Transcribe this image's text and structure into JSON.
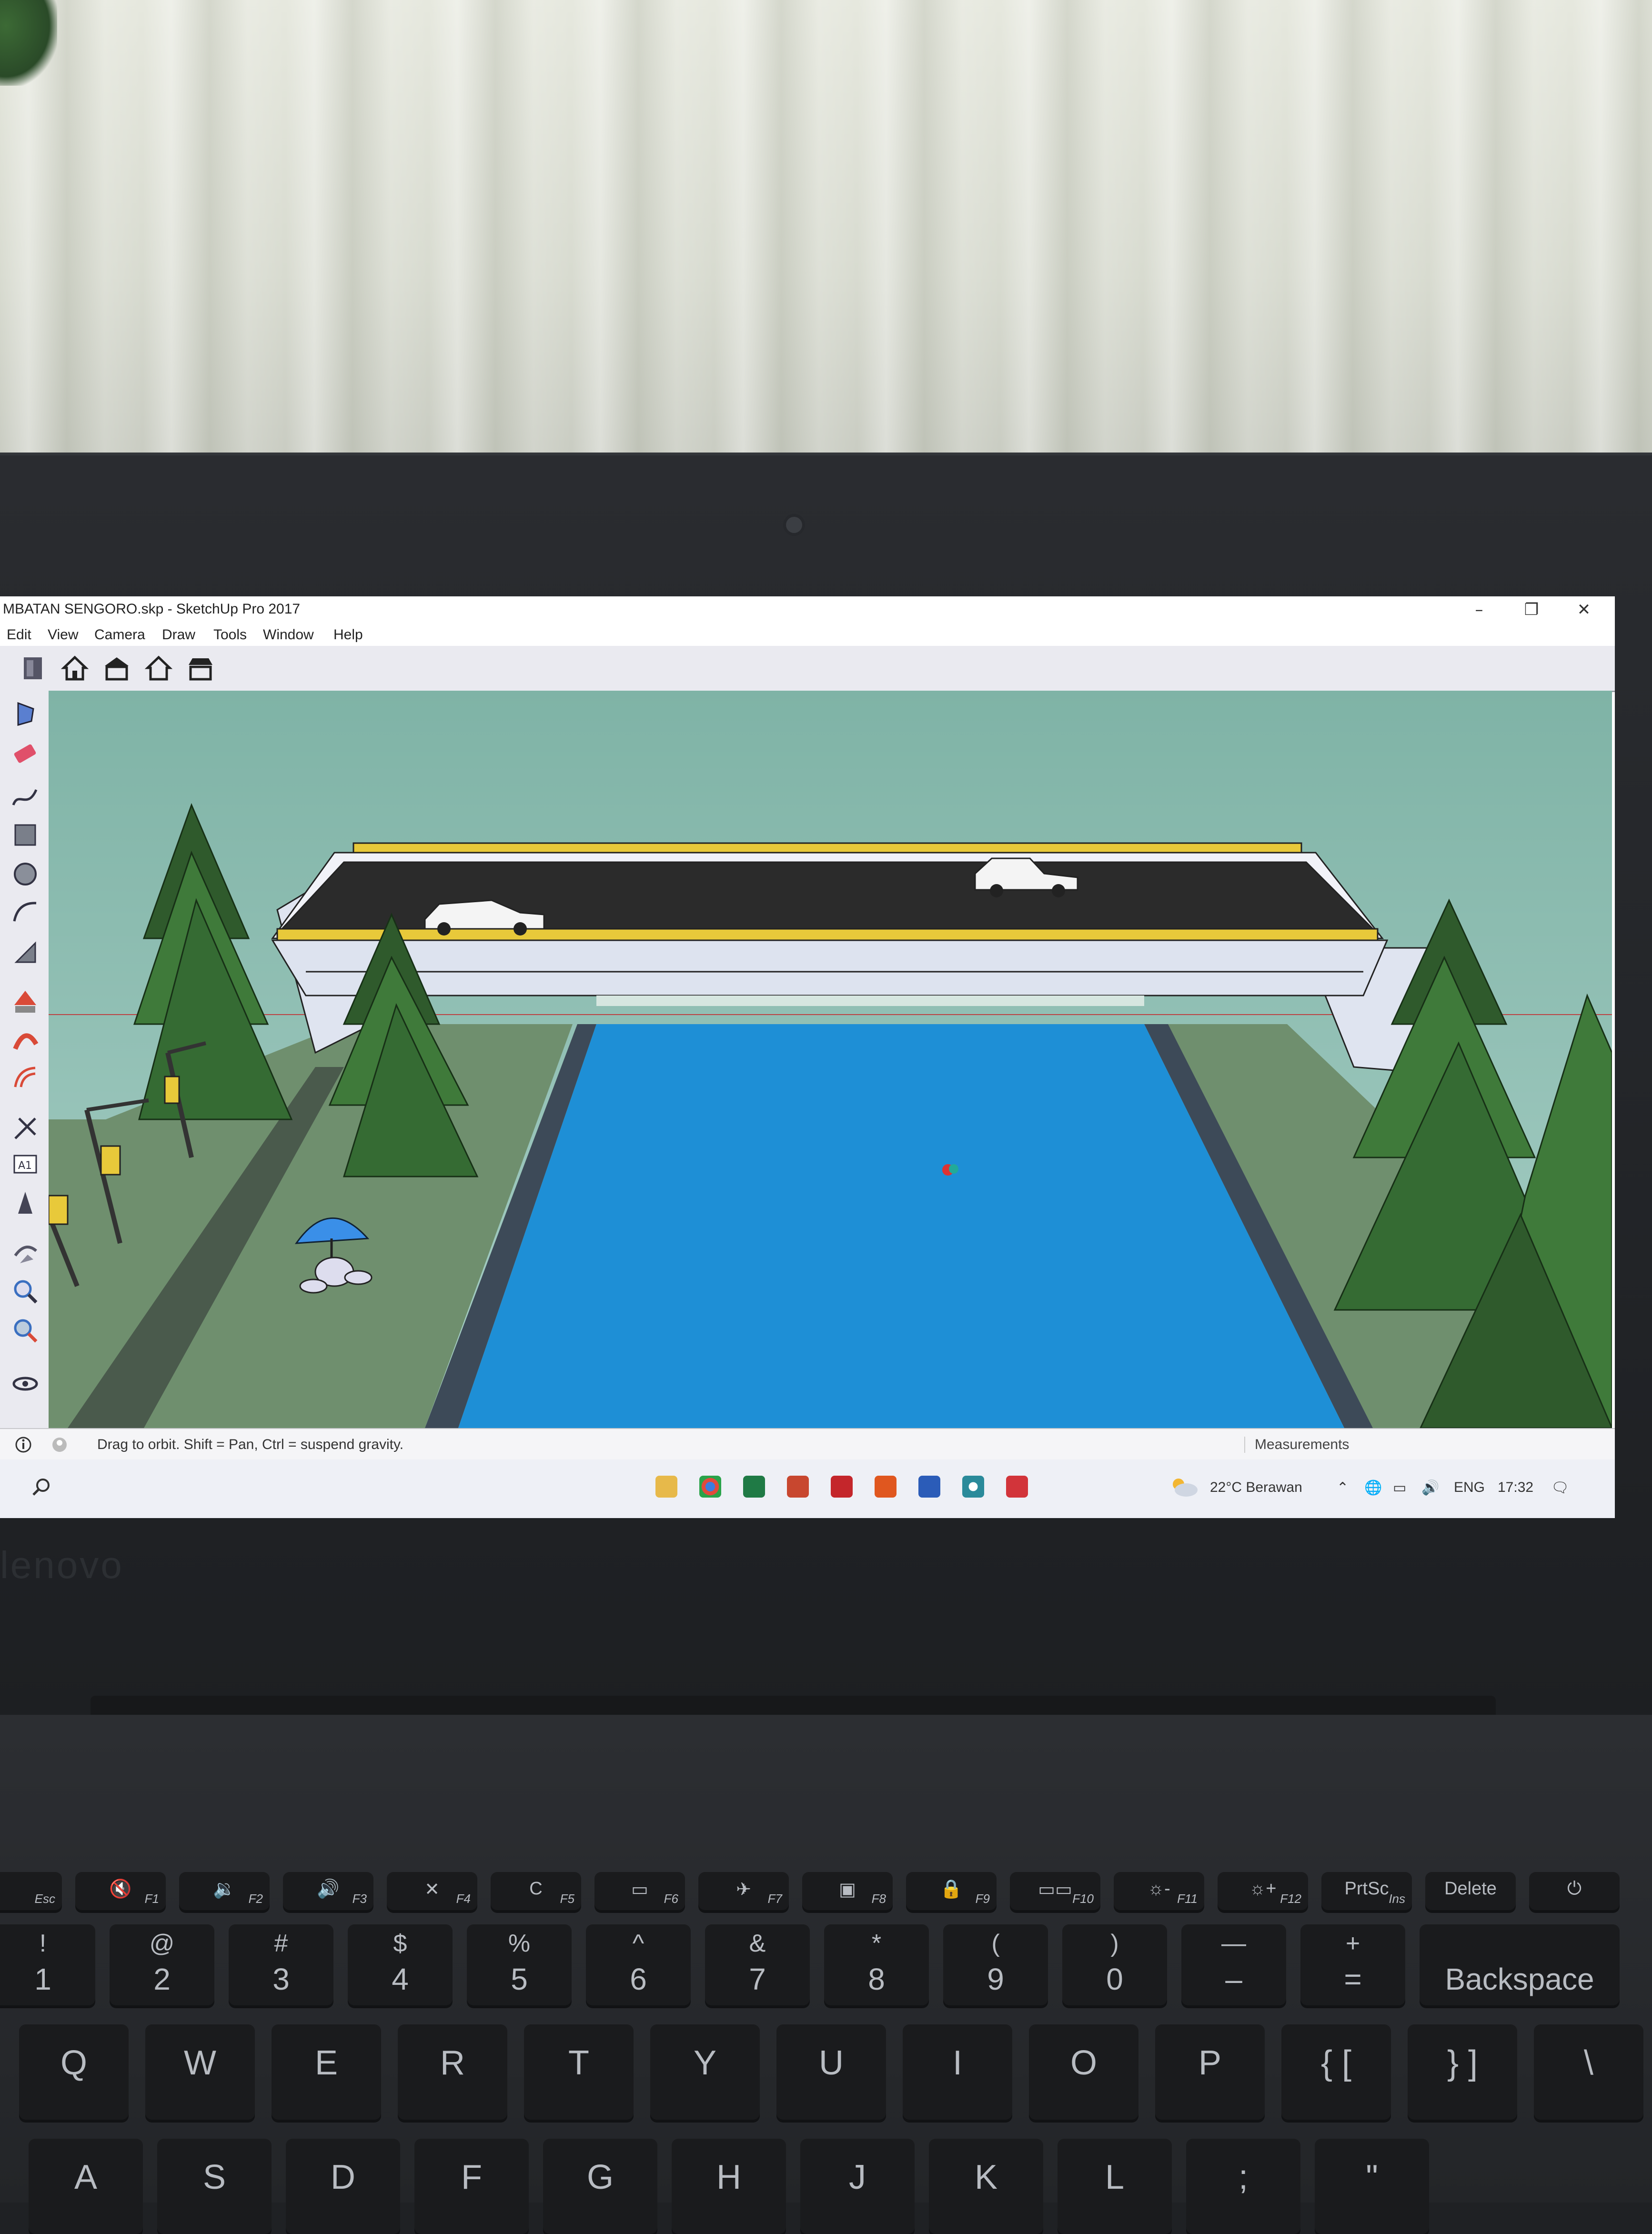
{
  "window": {
    "title": "MBATAN SENGORO.skp - SketchUp Pro 2017",
    "minimize": "–",
    "restore": "❐",
    "close": "✕"
  },
  "menu": {
    "items": [
      "Edit",
      "View",
      "Camera",
      "Draw",
      "Tools",
      "Window",
      "Help"
    ]
  },
  "toolbar": {
    "icons": [
      "component-icon",
      "home-view-icon",
      "front-view-icon",
      "house-outline-icon",
      "back-view-icon"
    ]
  },
  "left_toolbar": {
    "icons": [
      "select-icon",
      "eraser-icon",
      "freehand-icon",
      "rectangle-icon",
      "polygon-icon",
      "arc-icon",
      "pie-icon",
      "push-pull-icon",
      "follow-me-icon",
      "offset-icon",
      "tape-measure-icon",
      "text-icon",
      "3d-text-icon",
      "orbit-icon",
      "pan-icon",
      "zoom-icon",
      "zoom-extents-icon",
      "look-around-icon"
    ]
  },
  "status": {
    "hint": "Drag to orbit. Shift = Pan, Ctrl = suspend gravity.",
    "measurements_label": "Measurements"
  },
  "taskbar": {
    "apps": [
      "file-explorer-icon",
      "chrome-icon",
      "excel-icon",
      "powerpoint-icon",
      "acrobat-icon",
      "sketchup-layout-icon",
      "word-icon",
      "browser-icon",
      "sketchup-icon"
    ],
    "weather": "22°C  Berawan",
    "language": "ENG",
    "time": "17:32"
  },
  "colors": {
    "sky": "#8ebfb2",
    "water": "#1e8fd6",
    "ground": "#6f8f6e",
    "deck": "#2b2b2b",
    "guardrail": "#e8c93a"
  },
  "keyboard": {
    "fkeys": [
      {
        "main": "",
        "sub": "Esc"
      },
      {
        "main": "🔇",
        "sub": "F1"
      },
      {
        "main": "🔉",
        "sub": "F2"
      },
      {
        "main": "🔊",
        "sub": "F3"
      },
      {
        "main": "✕",
        "sub": "F4"
      },
      {
        "main": "C",
        "sub": "F5"
      },
      {
        "main": "▭",
        "sub": "F6"
      },
      {
        "main": "✈",
        "sub": "F7"
      },
      {
        "main": "▣",
        "sub": "F8"
      },
      {
        "main": "🔒",
        "sub": "F9"
      },
      {
        "main": "▭▭",
        "sub": "F10"
      },
      {
        "main": "☼-",
        "sub": "F11"
      },
      {
        "main": "☼+",
        "sub": "F12"
      },
      {
        "main": "PrtSc",
        "sub": "Ins"
      },
      {
        "main": "Delete",
        "sub": ""
      },
      {
        "main": "⏻",
        "sub": ""
      }
    ],
    "numbers": [
      {
        "top": "!",
        "main": "1"
      },
      {
        "top": "@",
        "main": "2"
      },
      {
        "top": "#",
        "main": "3"
      },
      {
        "top": "$",
        "main": "4"
      },
      {
        "top": "%",
        "main": "5"
      },
      {
        "top": "^",
        "main": "6"
      },
      {
        "top": "&",
        "main": "7"
      },
      {
        "top": "*",
        "main": "8"
      },
      {
        "top": "(",
        "main": "9"
      },
      {
        "top": ")",
        "main": "0"
      },
      {
        "top": "—",
        "main": "–"
      },
      {
        "top": "+",
        "main": "="
      },
      {
        "top": "",
        "main": "Backspace"
      }
    ],
    "qwerty": [
      "Q",
      "W",
      "E",
      "R",
      "T",
      "Y",
      "U",
      "I",
      "O",
      "P",
      "{ [",
      "} ]",
      "\\"
    ],
    "asdf": [
      "A",
      "S",
      "D",
      "F",
      "G",
      "H",
      "J",
      "K",
      "L",
      ";",
      "\""
    ]
  }
}
